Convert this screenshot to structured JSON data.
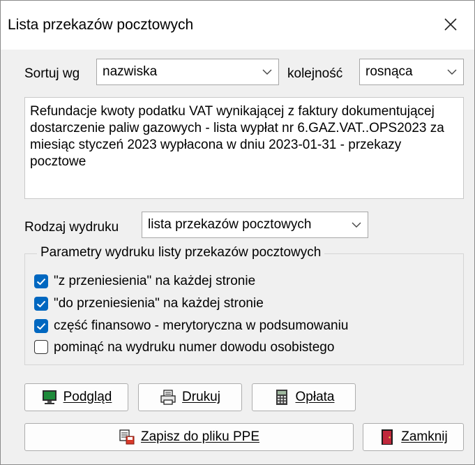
{
  "window": {
    "title": "Lista przekazów pocztowych"
  },
  "sort": {
    "label": "Sortuj wg",
    "value": "nazwiska",
    "order_label": "kolejność",
    "order_value": "rosnąca"
  },
  "description": "Refundacje kwoty podatku VAT wynikającej z faktury dokumentującej dostarczenie paliw gazowych - lista wypłat nr 6.GAZ.VAT..OPS2023 za miesiąc styczeń 2023 wypłacona w dniu 2023-01-31 - przekazy pocztowe",
  "print_type": {
    "label": "Rodzaj wydruku",
    "value": "lista przekazów pocztowych"
  },
  "params": {
    "legend": "Parametry wydruku listy przekazów pocztowych",
    "options": [
      {
        "label": "\"z przeniesienia\" na każdej stronie",
        "checked": true
      },
      {
        "label": "\"do przeniesienia\" na każdej stronie",
        "checked": true
      },
      {
        "label": "część finansowo - merytoryczna w podsumowaniu",
        "checked": true
      },
      {
        "label": "pominąć na wydruku numer dowodu osobistego",
        "checked": false
      }
    ]
  },
  "buttons": {
    "preview": "Podgląd",
    "print": "Drukuj",
    "fee": "Opłata",
    "save_ppe": "Zapisz do pliku PPE",
    "close": "Zamknij"
  },
  "icons": {
    "preview": "monitor-icon",
    "print": "printer-icon",
    "fee": "calculator-icon",
    "save_ppe": "save-to-file-icon",
    "close": "exit-door-icon"
  },
  "colors": {
    "checkbox_accent": "#0067c0",
    "window_bg": "#f0f0f0"
  }
}
